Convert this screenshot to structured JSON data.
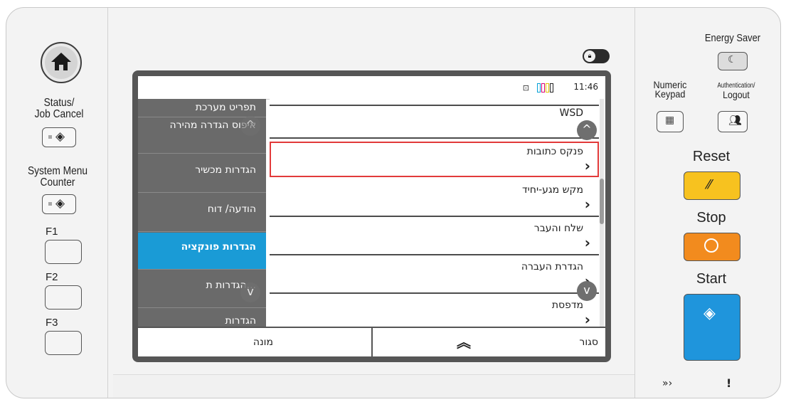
{
  "left_panel": {
    "status_label": "Status/\nJob Cancel",
    "system_menu_label": "System Menu\nCounter",
    "f1": "F1",
    "f2": "F2",
    "f3": "F3"
  },
  "screen": {
    "clock": "11:46",
    "tabs": [
      {
        "label": "תפריט מערכת",
        "active": false
      },
      {
        "label": "איפוס הגדרה מהירה",
        "active": false
      },
      {
        "label": "הגדרות מכשיר",
        "active": false
      },
      {
        "label": "הודעה/ דוח",
        "active": false
      },
      {
        "label": "הגדרות פונקציה",
        "active": true
      },
      {
        "label": "הגדרות ת...",
        "active": false
      },
      {
        "label": "הגדרות",
        "active": false
      }
    ],
    "rows": [
      {
        "label": "WSD",
        "highlighted": false
      },
      {
        "label": "פנקס כתובות",
        "highlighted": true
      },
      {
        "label": "מקש מגע-יחיד",
        "highlighted": false
      },
      {
        "label": "שלח והעבר",
        "highlighted": false
      },
      {
        "label": "הגדרת העברה",
        "highlighted": false
      },
      {
        "label": "מדפסת",
        "highlighted": false
      }
    ],
    "bottom": {
      "counter_label": "מונה",
      "close_label": "סגור"
    }
  },
  "right_panel": {
    "energy_saver": "Energy Saver",
    "numeric_keypad": "Numeric\nKeypad",
    "auth_logout_small": "Authentication/",
    "auth_logout_large": "Logout",
    "reset": "Reset",
    "stop": "Stop",
    "start": "Start",
    "colors": {
      "reset": "#f7c21f",
      "stop": "#f28b1e",
      "start": "#1f95dc"
    }
  }
}
